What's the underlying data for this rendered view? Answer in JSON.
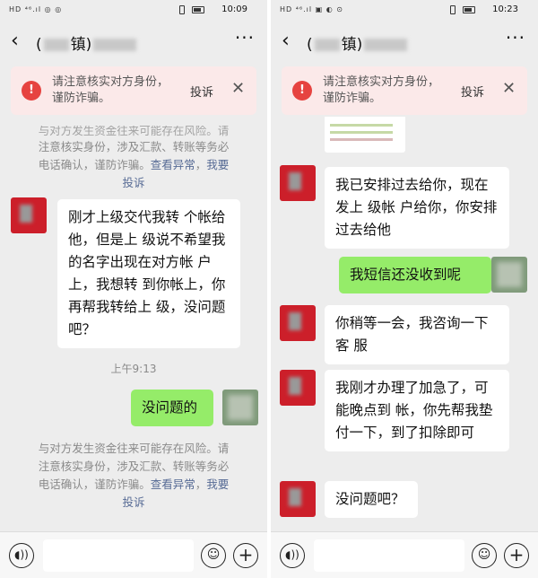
{
  "left": {
    "status": {
      "signal": "HD ⁴⁶.ıl ◎ ◎",
      "time": "10:09"
    },
    "title_open": "(",
    "title_visible": "镇)",
    "warning": {
      "text": "请注意核实对方身份，谨防诈骗。",
      "report": "投诉",
      "close": "✕"
    },
    "sysnote_top": {
      "line1": "与对方发生资金往来可能存在风险。请",
      "line2": "注意核实身份，涉及汇款、转账等务必",
      "line3_a": "电话确认，谨防诈骗。",
      "link1": "查看异常",
      "link2": "我要",
      "line4": "投诉"
    },
    "msg1": "刚才上级交代我转 个帐给他，但是上 级说不希望我的名字出现在对方帐 户上，我想转 到你帐上，你再帮我转给上 级，没问题吧？",
    "timestamp": "上午9:13",
    "msg2": "没问题的",
    "sysnote_bottom": {
      "line1": "与对方发生资金往来可能存在风险。请",
      "line2": "注意核实身份，涉及汇款、转账等务必",
      "line3_a": "电话确认，谨防诈骗。",
      "link1": "查看异常",
      "link2": "我要",
      "line4": "投诉"
    }
  },
  "right": {
    "status": {
      "signal": "HD ⁴⁶.ıl ▣ ◐ ⊙",
      "time": "10:23"
    },
    "title_open": "(",
    "title_visible": "镇)",
    "warning": {
      "text": "请注意核实对方身份，谨防诈骗。",
      "report": "投诉",
      "close": "✕"
    },
    "msg1": "我已安排过去给你，现在发上 级帐 户给你，你安排过去给他",
    "msg2": "我短信还没收到呢",
    "msg3": "你稍等一会，我咨询一下客 服",
    "msg4": "我刚才办理了加急了，可能晚点到 帐，你先帮我垫 付一下，到了扣除即可",
    "msg5": "没问题吧？"
  },
  "icons": {
    "back": "‹",
    "more": "···",
    "voice": "◖))",
    "emoji": "☺",
    "plus": "+"
  },
  "colors": {
    "outgoing_bubble": "#95ec69",
    "incoming_bubble": "#ffffff",
    "warning_bg": "#fbe9e9",
    "warning_icon": "#e64340",
    "link": "#576b95"
  }
}
